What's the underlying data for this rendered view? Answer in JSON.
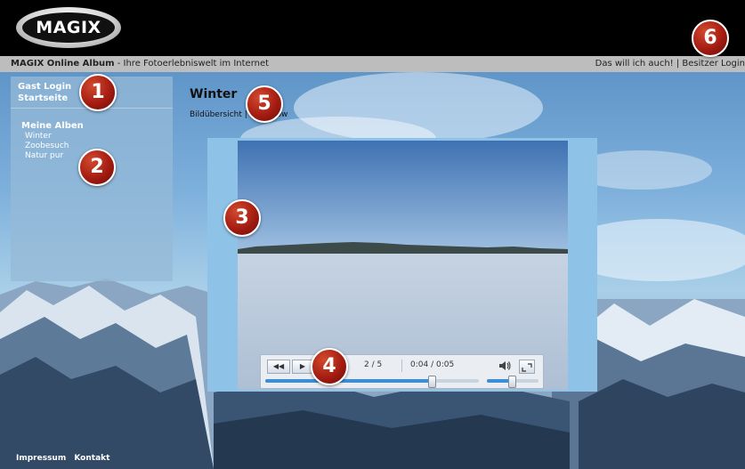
{
  "header": {
    "logo_text": "MAGIX",
    "site_title_bold": "MAGIX Online Album",
    "site_title_rest": " - Ihre Fotoerlebniswelt im Internet",
    "link_want": "Das will ich auch!",
    "separator": " | ",
    "link_owner_login": "Besitzer Login"
  },
  "sidebar": {
    "guest_login": "Gast Login",
    "home": "Startseite",
    "albums_heading": "Meine Alben",
    "albums": [
      "Winter",
      "Zoobesuch",
      "Natur pur"
    ]
  },
  "main": {
    "title": "Winter",
    "subtitle_links": "Bildübersicht | Fotoshow"
  },
  "player": {
    "counter": "2 / 5",
    "time": "0:04 / 0:05",
    "progress_fraction": 0.78,
    "volume_fraction": 0.48,
    "prev_icon": "skip-back-icon",
    "play_icon": "play-icon",
    "volume_icon": "speaker-icon",
    "fullscreen_icon": "fullscreen-icon"
  },
  "footer": {
    "imprint": "Impressum",
    "contact": "Kontakt"
  },
  "markers": [
    "1",
    "2",
    "3",
    "4",
    "5",
    "6"
  ],
  "colors": {
    "header_bg": "#000000",
    "subbar_bg": "#bdbdbd",
    "marker_red": "#a51c12",
    "player_frame": "#8ec2e6",
    "progress_blue": "#3d8ed8"
  }
}
